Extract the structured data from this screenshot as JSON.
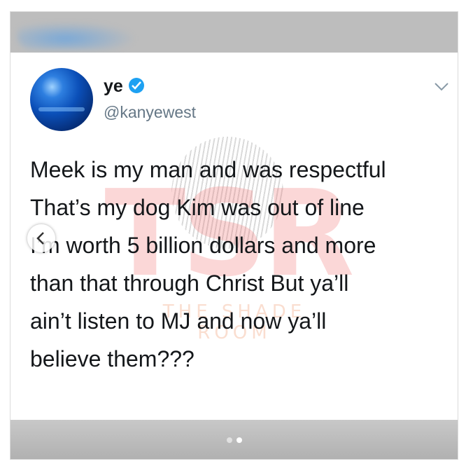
{
  "tweet": {
    "name": "ye",
    "handle": "@kanyewest",
    "lines": [
      "Meek is my man and was respectful",
      "That’s my dog    Kim was out of line",
      "I’m worth 5 billion dollars and more",
      "than that through Christ      But ya’ll",
      "ain’t listen to MJ and now ya’ll",
      "believe them???"
    ]
  },
  "watermark": {
    "letters": "TSR",
    "subtitle": "THE SHADE ROOM"
  },
  "carousel": {
    "total_slides": 2,
    "current_slide": 2
  },
  "colors": {
    "verified": "#1da1f2",
    "handle": "#657786",
    "text": "#14171a"
  },
  "icons": [
    "verified-icon",
    "chevron-down-icon",
    "chevron-left-icon"
  ]
}
